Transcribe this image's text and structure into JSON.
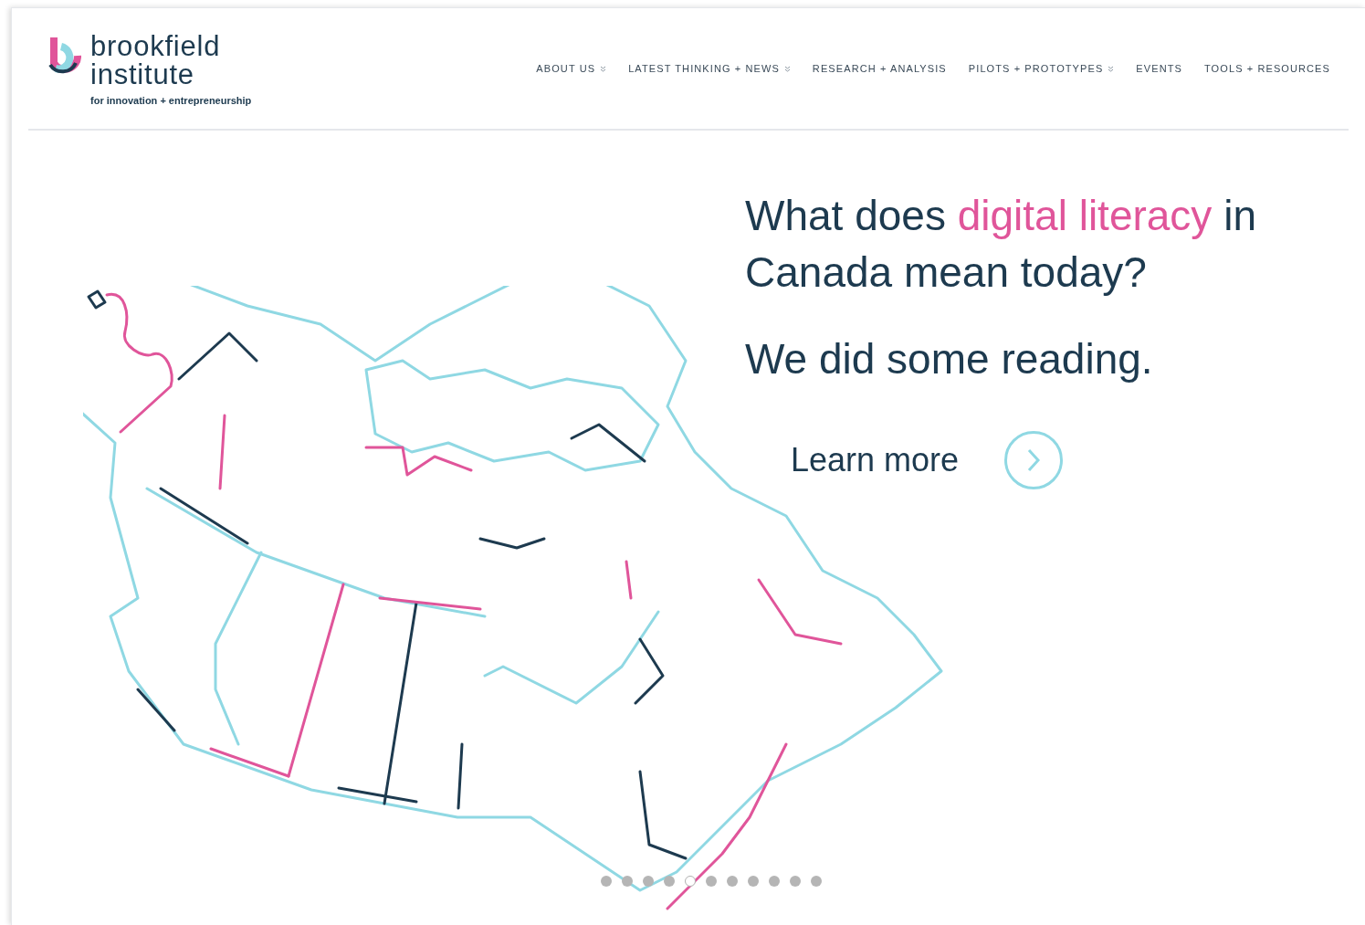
{
  "logo": {
    "name_line1": "brookfield",
    "name_line2": "institute",
    "tagline": "for innovation + entrepreneurship"
  },
  "nav": [
    {
      "label": "ABOUT US",
      "has_dropdown": true
    },
    {
      "label": "LATEST THINKING + NEWS",
      "has_dropdown": true
    },
    {
      "label": "RESEARCH + ANALYSIS",
      "has_dropdown": false
    },
    {
      "label": "PILOTS + PROTOTYPES",
      "has_dropdown": true
    },
    {
      "label": "EVENTS",
      "has_dropdown": false
    },
    {
      "label": "TOOLS + RESOURCES",
      "has_dropdown": false
    }
  ],
  "hero": {
    "headline": [
      {
        "text": "What does ",
        "highlight": false
      },
      {
        "text": "digital literacy",
        "highlight": true
      },
      {
        "text": " in Canada mean today?",
        "highlight": false
      }
    ],
    "subheadline": "We did some reading.",
    "cta": "Learn more"
  },
  "carousel_dots": [
    {
      "selected": false
    },
    {
      "selected": false
    },
    {
      "selected": false
    },
    {
      "selected": false
    },
    {
      "selected": true
    },
    {
      "selected": false
    },
    {
      "selected": false
    },
    {
      "selected": false
    },
    {
      "selected": false
    },
    {
      "selected": false
    },
    {
      "selected": false
    }
  ]
}
